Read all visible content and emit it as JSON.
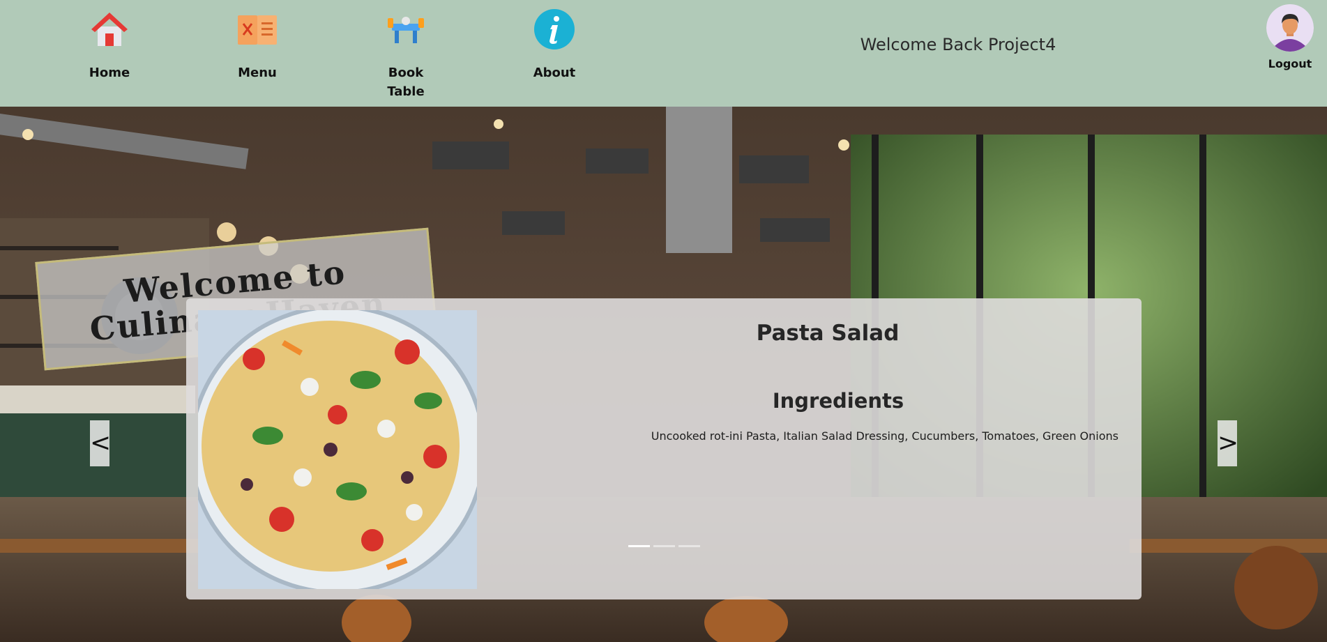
{
  "nav": {
    "items": [
      {
        "label": "Home",
        "icon": "home-icon"
      },
      {
        "label": "Menu",
        "icon": "menu-icon"
      },
      {
        "label": "Book Table",
        "icon": "book-table-icon"
      },
      {
        "label": "About",
        "icon": "info-icon"
      }
    ]
  },
  "header": {
    "welcome": "Welcome Back Project4",
    "logout_label": "Logout",
    "avatar_icon": "avatar-icon",
    "background_color": "#b1cab8"
  },
  "hero": {
    "sign_text": "Welcome to Culinary Haven"
  },
  "carousel": {
    "title": "Pasta Salad",
    "ingredients_heading": "Ingredients",
    "ingredients": "Uncooked rot-ini Pasta, Italian Salad Dressing, Cucumbers, Tomatoes, Green Onions",
    "prev_label": "<",
    "next_label": ">",
    "slide_count": 3,
    "active_slide": 1
  }
}
